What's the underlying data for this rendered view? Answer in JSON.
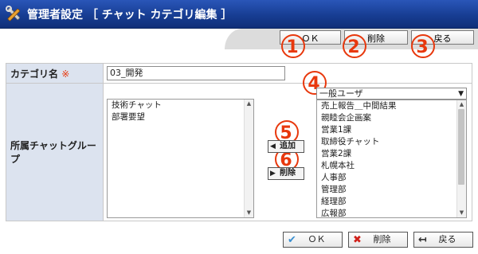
{
  "header": {
    "title": "管理者設定 ［ チャット カテゴリ編集 ］",
    "icon": "tools-icon"
  },
  "top_buttons": {
    "ok": "ＯＫ",
    "delete": "削除",
    "back": "戻る"
  },
  "markers": [
    "1",
    "2",
    "3",
    "4",
    "5",
    "6"
  ],
  "form": {
    "category_label": "カテゴリ名",
    "required_mark": "※",
    "category_value": "03_開発",
    "group_label": "所属チャットグループ"
  },
  "left_list": {
    "items": [
      "技術チャット",
      "部署要望"
    ]
  },
  "user_filter": {
    "selected": "一般ユーザ"
  },
  "right_list": {
    "items": [
      "売上報告＿中間結果",
      "親睦会企画案",
      "営業1課",
      "取締役チャット",
      "営業2課",
      "札幌本社",
      "人事部",
      "管理部",
      "経理部",
      "広報部"
    ]
  },
  "middle_buttons": {
    "add": "追加",
    "remove": "削除"
  },
  "bottom_buttons": {
    "ok": "ＯＫ",
    "delete": "削除",
    "back": "戻る"
  },
  "colors": {
    "header_blue": "#173d93",
    "marker_red": "#e8380d",
    "label_bg": "#dce3ef"
  }
}
